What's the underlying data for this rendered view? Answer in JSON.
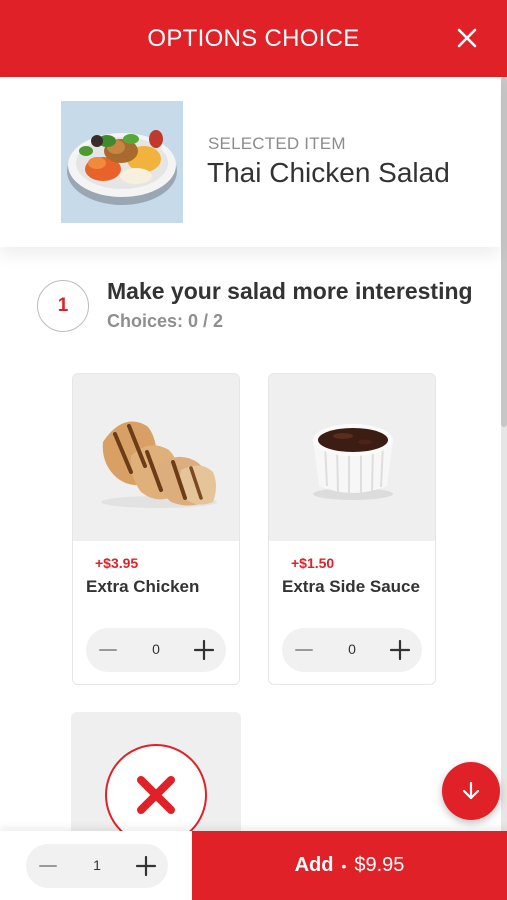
{
  "header": {
    "title": "OPTIONS CHOICE",
    "close_icon": "close-icon"
  },
  "selected": {
    "label": "SELECTED ITEM",
    "name": "Thai Chicken Salad",
    "image_icon": "salad-bowl-image"
  },
  "section": {
    "step": "1",
    "title": "Make your salad more interesting",
    "choices": "Choices: 0 / 2"
  },
  "options": [
    {
      "price": "+$3.95",
      "name": "Extra Chicken",
      "qty": "0",
      "image_icon": "grilled-chicken-image"
    },
    {
      "price": "+$1.50",
      "name": "Extra Side Sauce",
      "qty": "0",
      "image_icon": "sauce-ramekin-image"
    }
  ],
  "none_option": {
    "icon": "x-cross-icon"
  },
  "footer": {
    "qty": "1",
    "add_label": "Add",
    "separator": "•",
    "total": "$9.95"
  },
  "colors": {
    "brand": "#e02127",
    "muted": "#8f8f8f",
    "card_bg": "#efefef"
  }
}
